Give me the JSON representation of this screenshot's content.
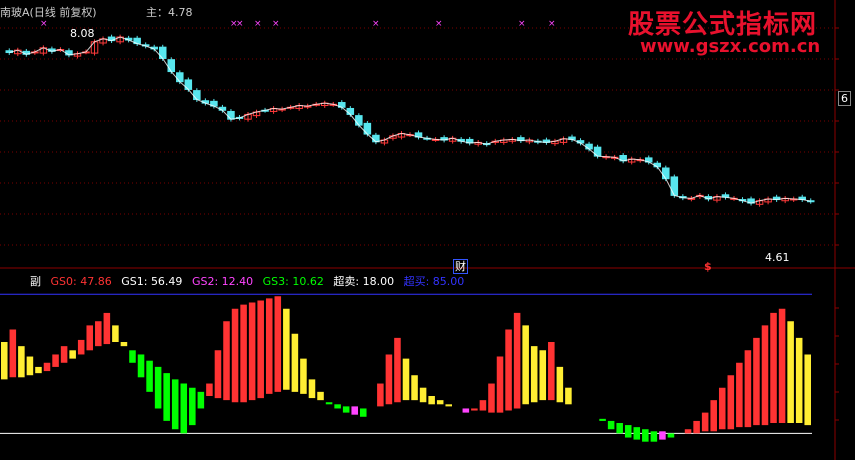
{
  "colors": {
    "up": "#ff3a3a",
    "down": "#58e6ee",
    "grid": "#7a0000",
    "frame": "#8b0000",
    "white": "#ffffff",
    "x_marker": "#ff44ff",
    "gs0": "#ff3333",
    "gs1": "#ffffff",
    "gs2": "#ff44ff",
    "gs3": "#00ff00",
    "sell": "#ffffff",
    "buy": "#3333ff",
    "yellow": "#ffee33"
  },
  "header": {
    "title": "南玻A(日线 前复权)",
    "main_label": "主：4.78"
  },
  "price_chart": {
    "high_label": "8.08",
    "low_label": "4.61",
    "ylim": [
      4.2,
      8.4
    ],
    "right_axis_label": "6",
    "fin_marker": "财",
    "dollar_marker": "$",
    "x_markers_count": 9,
    "close": [
      7.82,
      7.86,
      7.79,
      7.83,
      7.9,
      7.84,
      7.87,
      7.78,
      7.8,
      7.83,
      8.0,
      8.05,
      8.02,
      8.08,
      8.03,
      7.97,
      7.93,
      7.88,
      7.72,
      7.5,
      7.33,
      7.2,
      7.03,
      6.97,
      6.92,
      6.85,
      6.7,
      6.72,
      6.78,
      6.82,
      6.85,
      6.88,
      6.87,
      6.9,
      6.93,
      6.92,
      6.95,
      6.97,
      6.95,
      6.9,
      6.78,
      6.6,
      6.45,
      6.32,
      6.35,
      6.42,
      6.46,
      6.44,
      6.4,
      6.38,
      6.36,
      6.35,
      6.38,
      6.33,
      6.3,
      6.31,
      6.28,
      6.33,
      6.35,
      6.36,
      6.34,
      6.35,
      6.32,
      6.31,
      6.33,
      6.37,
      6.36,
      6.3,
      6.2,
      6.08,
      6.07,
      6.06,
      6.0,
      6.03,
      6.02,
      5.98,
      5.9,
      5.7,
      5.42,
      5.38,
      5.37,
      5.42,
      5.36,
      5.4,
      5.39,
      5.37,
      5.33,
      5.29,
      5.33,
      5.36,
      5.35,
      5.37,
      5.36,
      5.35,
      5.32
    ],
    "volume_note": ""
  },
  "sub_chart": {
    "label": "副",
    "indicators": [
      {
        "name": "GS0",
        "value": "47.86"
      },
      {
        "name": "GS1",
        "value": "56.49"
      },
      {
        "name": "GS2",
        "value": "12.40"
      },
      {
        "name": "GS3",
        "value": "10.62"
      },
      {
        "name": "超卖",
        "value": "18.00"
      },
      {
        "name": "超买",
        "value": "85.00"
      }
    ],
    "ylim": [
      10,
      88
    ],
    "sell_line": 18,
    "buy_line": 85,
    "gs0": [
      62,
      68,
      60,
      55,
      50,
      52,
      56,
      60,
      58,
      63,
      70,
      72,
      76,
      70,
      62,
      52,
      45,
      38,
      30,
      24,
      20,
      18,
      22,
      30,
      42,
      58,
      72,
      78,
      80,
      81,
      82,
      83,
      84,
      78,
      66,
      54,
      44,
      38,
      32,
      30,
      28,
      27,
      26,
      30,
      42,
      56,
      64,
      54,
      46,
      40,
      36,
      34,
      32,
      30,
      28,
      30,
      34,
      42,
      55,
      68,
      76,
      70,
      60,
      58,
      62,
      50,
      40,
      30,
      28,
      26,
      24,
      20,
      18,
      16,
      15,
      14,
      14,
      15,
      16,
      18,
      20,
      24,
      28,
      34,
      40,
      46,
      52,
      58,
      64,
      70,
      76,
      78,
      72,
      64,
      56
    ],
    "ma": [
      44,
      45,
      45,
      46,
      47,
      48,
      50,
      52,
      54,
      56,
      58,
      60,
      61,
      62,
      60,
      58,
      56,
      53,
      50,
      47,
      44,
      42,
      40,
      38,
      36,
      35,
      34,
      33,
      33,
      34,
      35,
      37,
      38,
      39,
      38,
      37,
      35,
      34,
      33,
      32,
      31,
      31,
      30,
      30,
      31,
      32,
      33,
      34,
      34,
      33,
      32,
      32,
      31,
      30,
      30,
      29,
      29,
      28,
      28,
      29,
      30,
      32,
      33,
      34,
      34,
      33,
      32,
      30,
      28,
      26,
      25,
      24,
      23,
      22,
      21,
      20,
      19,
      19,
      18,
      18,
      18,
      18,
      19,
      19,
      20,
      20,
      21,
      21,
      22,
      22,
      23,
      23,
      23,
      23,
      22
    ]
  }
}
